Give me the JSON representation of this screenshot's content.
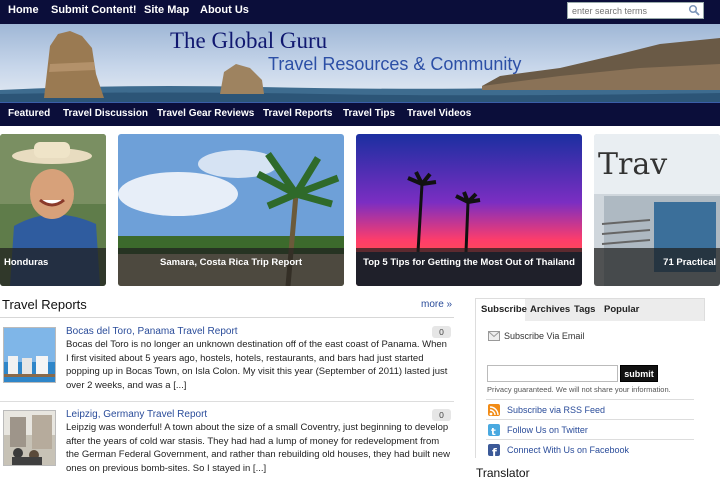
{
  "topnav": {
    "items": [
      {
        "label": "Home"
      },
      {
        "label": "Submit Content!"
      },
      {
        "label": "Site Map"
      },
      {
        "label": "About Us"
      }
    ],
    "search_placeholder": "enter search terms"
  },
  "banner": {
    "title": "The Global Guru",
    "tagline": "Travel Resources & Community"
  },
  "catnav": {
    "items": [
      {
        "label": "Featured"
      },
      {
        "label": "Travel Discussion"
      },
      {
        "label": "Travel Gear Reviews"
      },
      {
        "label": "Travel Reports"
      },
      {
        "label": "Travel Tips"
      },
      {
        "label": "Travel Videos"
      }
    ]
  },
  "slider": {
    "slides": [
      {
        "caption": "Honduras"
      },
      {
        "caption": "Samara, Costa Rica Trip Report"
      },
      {
        "caption": "Top 5 Tips for Getting the Most Out of Thailand"
      },
      {
        "caption": "71 Practical"
      }
    ]
  },
  "reports": {
    "heading": "Travel Reports",
    "more": "more »",
    "items": [
      {
        "title": "Bocas del Toro, Panama Travel Report",
        "comments": "0",
        "excerpt": "Bocas del Toro is no longer an unknown destination off of the east coast of Panama. When I first visited about 5 years ago, hostels, hotels, restaurants, and bars had just started popping up in Bocas Town, on Isla Colon. My visit this year (September of 2011) lasted just over 2 weeks, and was a [...]"
      },
      {
        "title": "Leipzig, Germany Travel Report",
        "comments": "0",
        "excerpt": "Leipzig was wonderful! A town about the size of a small Coventry, just beginning to develop after the years of cold war stasis. They had had a lump of money for redevelopment from the German Federal Government, and rather than rebuilding old houses, they had built new ones on previous bomb-sites. So I stayed in [...]"
      }
    ]
  },
  "sidebar": {
    "tabs": [
      {
        "label": "Subscribe"
      },
      {
        "label": "Archives"
      },
      {
        "label": "Tags"
      },
      {
        "label": "Popular"
      }
    ],
    "email_label": "Subscribe Via Email",
    "submit": "submit",
    "privacy": "Privacy guaranteed. We will not share your information.",
    "links": [
      {
        "label": "Subscribe via RSS Feed",
        "icon": "rss-icon",
        "color": "#f18b16"
      },
      {
        "label": "Follow Us on Twitter",
        "icon": "twitter-icon",
        "color": "#4aa9e0"
      },
      {
        "label": "Connect With Us on Facebook",
        "icon": "facebook-icon",
        "color": "#3b5998"
      }
    ]
  },
  "translator": {
    "heading": "Translator"
  }
}
